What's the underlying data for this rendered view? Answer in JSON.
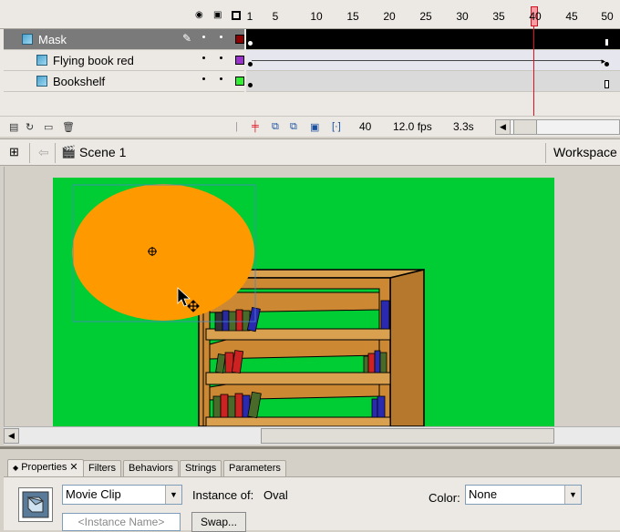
{
  "timeline": {
    "header_icons": {
      "eye": "eye-icon",
      "lock": "lock-icon",
      "outline": "outline-icon"
    },
    "ruler": [
      "1",
      "5",
      "10",
      "15",
      "20",
      "25",
      "30",
      "35",
      "40",
      "45",
      "50"
    ],
    "layers": [
      {
        "name": "Mask",
        "type": "mask",
        "color": "#8b0000",
        "selected": true
      },
      {
        "name": "Flying book red",
        "type": "masked",
        "color": "#9933cc"
      },
      {
        "name": "Bookshelf",
        "type": "masked",
        "color": "#33cc33"
      }
    ],
    "footer": {
      "current_frame": "40",
      "fps": "12.0 fps",
      "elapsed": "3.3s"
    }
  },
  "editbar": {
    "scene": "Scene 1",
    "workspace": "Workspace"
  },
  "properties": {
    "tabs": [
      "Properties",
      "Filters",
      "Behaviors",
      "Strings",
      "Parameters"
    ],
    "symbol_type": "Movie Clip",
    "instance_of_label": "Instance of:",
    "instance_of_value": "Oval",
    "color_label": "Color:",
    "color_value": "None",
    "instance_name_placeholder": "<Instance Name>",
    "swap_label": "Swap..."
  },
  "colors": {
    "stage": "#00cc33",
    "oval": "#ff9900",
    "shelf": "#cc8833",
    "playhead": "#e01020"
  }
}
